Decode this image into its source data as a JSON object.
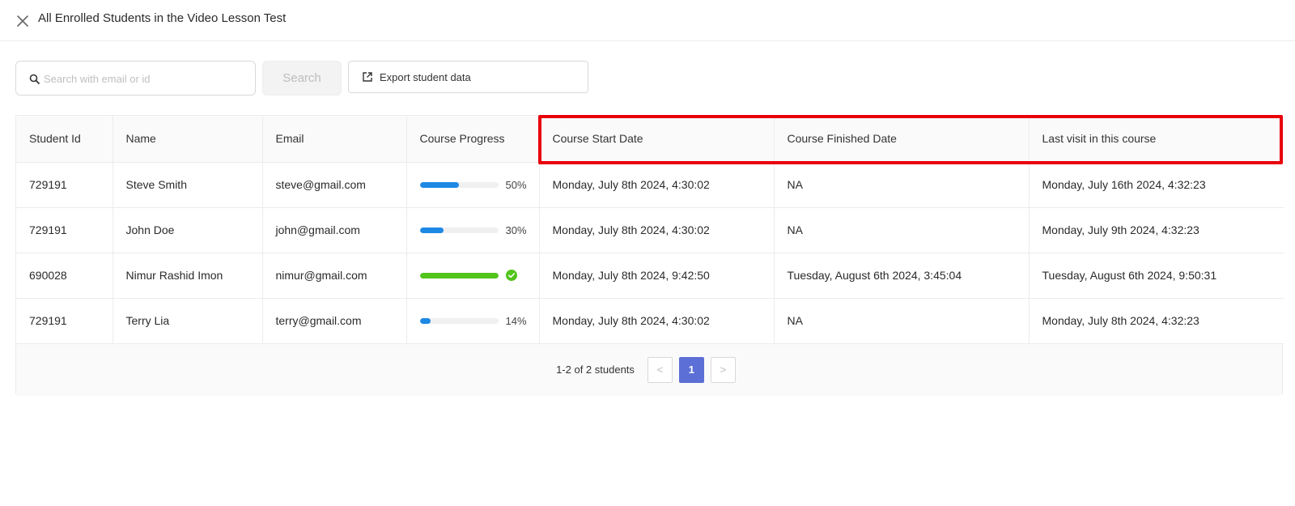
{
  "header": {
    "title": "All Enrolled Students in the Video Lesson Test",
    "close_icon": "close-icon"
  },
  "toolbar": {
    "search_placeholder": "Search with email or id",
    "search_value": "",
    "search_label": "Search",
    "export_label": "Export student data",
    "search_icon": "search-icon",
    "export_icon": "external-link-icon"
  },
  "table": {
    "columns": [
      "Student Id",
      "Name",
      "Email",
      "Course Progress",
      "Course Start Date",
      "Course Finished Date",
      "Last visit in this course"
    ],
    "rows": [
      {
        "id": "729191",
        "name": "Steve Smith",
        "email": "steve@gmail.com",
        "progress": 50,
        "progress_label": "50%",
        "complete": false,
        "start": "Monday, July 8th 2024, 4:30:02",
        "finished": "NA",
        "last_visit": "Monday, July 16th 2024, 4:32:23"
      },
      {
        "id": "729191",
        "name": "John Doe",
        "email": "john@gmail.com",
        "progress": 30,
        "progress_label": "30%",
        "complete": false,
        "start": "Monday, July 8th 2024, 4:30:02",
        "finished": "NA",
        "last_visit": "Monday, July 9th 2024, 4:32:23"
      },
      {
        "id": "690028",
        "name": "Nimur Rashid Imon",
        "email": "nimur@gmail.com",
        "progress": 100,
        "progress_label": "",
        "complete": true,
        "start": "Monday, July 8th 2024, 9:42:50",
        "finished": "Tuesday, August 6th 2024, 3:45:04",
        "last_visit": "Tuesday, August 6th 2024, 9:50:31"
      },
      {
        "id": "729191",
        "name": "Terry Lia",
        "email": "terry@gmail.com",
        "progress": 14,
        "progress_label": "14%",
        "complete": false,
        "start": "Monday, July 8th 2024, 4:30:02",
        "finished": "NA",
        "last_visit": "Monday, July 8th 2024, 4:32:23"
      }
    ]
  },
  "pagination": {
    "summary": "1-2 of 2 students",
    "current_page": "1",
    "prev": "<",
    "next": ">"
  },
  "colors": {
    "progress_blue": "#1e88e5",
    "progress_green": "#52c41a",
    "accent": "#5b6fd6",
    "highlight": "#e8000b"
  }
}
